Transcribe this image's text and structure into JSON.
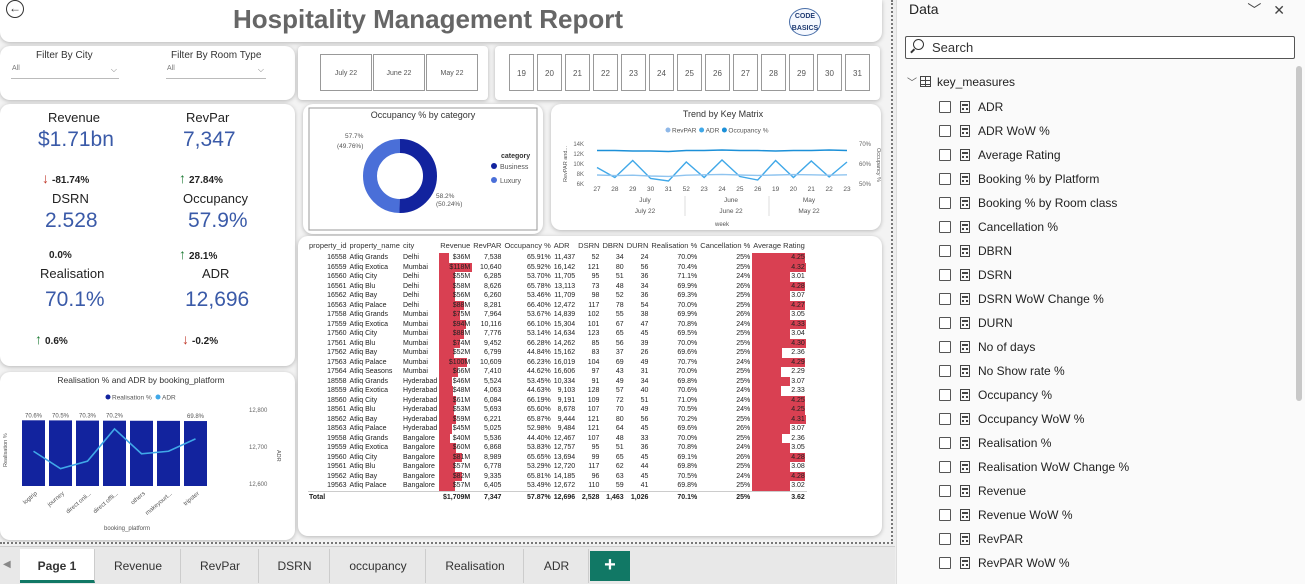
{
  "report": {
    "title": "Hospitality Management Report",
    "logo_text": "CODE BASICS"
  },
  "filters": {
    "city": {
      "label": "Filter By City",
      "value": "All"
    },
    "room_type": {
      "label": "Filter By Room Type",
      "value": "All"
    }
  },
  "months": [
    "July 22",
    "June 22",
    "May 22"
  ],
  "weeks": [
    "19",
    "20",
    "21",
    "22",
    "23",
    "24",
    "25",
    "26",
    "27",
    "28",
    "29",
    "30",
    "31"
  ],
  "kpis": {
    "revenue": {
      "label": "Revenue",
      "value": "$1.71bn",
      "change": "-81.74%"
    },
    "revpar": {
      "label": "RevPar",
      "value": "7,347",
      "change": "27.84%"
    },
    "dsrn": {
      "label": "DSRN",
      "value": "2.528",
      "change": "0.0%"
    },
    "occupancy": {
      "label": "Occupancy",
      "value": "57.9%",
      "change": "28.1%"
    },
    "realisation": {
      "label": "Realisation",
      "value": "70.1%",
      "change": "0.6%"
    },
    "adr": {
      "label": "ADR",
      "value": "12,696",
      "change": "-0.2%"
    }
  },
  "colors": {
    "business": "#12239e",
    "luxury": "#4a6fd8",
    "bar_red": "#d94052",
    "kpi_blue": "#3a5aa8",
    "accent": "#117865",
    "adr_line": "#40a8e8"
  },
  "chart_data": [
    {
      "type": "pie",
      "title": "Occupancy % by category",
      "legend_title": "category",
      "categories": [
        "Business",
        "Luxury"
      ],
      "values": [
        50.24,
        49.76
      ],
      "labels": [
        [
          "58.2%",
          "(50.24%)"
        ],
        [
          "57.7%",
          "(49.76%)"
        ]
      ]
    },
    {
      "type": "line",
      "title": "Trend by Key Matrix",
      "series_names": [
        "RevPAR",
        "ADR",
        "Occupancy %"
      ],
      "x": [
        "27",
        "28",
        "29",
        "30",
        "31",
        "52",
        "23",
        "24",
        "25",
        "26",
        "19",
        "20",
        "21",
        "22",
        "23"
      ],
      "x_groups": [
        {
          "month": "July",
          "label": "July 22"
        },
        {
          "month": "June",
          "label": "June 22"
        },
        {
          "month": "May",
          "label": "May 22"
        }
      ],
      "xlabel": "week",
      "ylabel": "RevPAR and...",
      "ylabel_right": "Occupancy %",
      "yticks_left": [
        "14K",
        "12K",
        "10K",
        "8K",
        "6K"
      ],
      "yticks_right": [
        "70%",
        "60%",
        "50%"
      ],
      "series": [
        {
          "name": "ADR",
          "values": [
            12.7,
            12.7,
            12.6,
            12.6,
            12.5,
            12.7,
            12.7,
            12.8,
            12.7,
            12.7,
            12.6,
            12.7,
            12.7,
            12.8,
            12.7
          ]
        },
        {
          "name": "RevPAR",
          "values": [
            9.3,
            7.3,
            10.7,
            7.1,
            6.6,
            10.4,
            7.3,
            10.8,
            7.5,
            6.8,
            10.7,
            7.3,
            10.6,
            7.4,
            10.4
          ]
        },
        {
          "name": "Occupancy %",
          "values": [
            56.5,
            56.2,
            56.4,
            56.0,
            55.8,
            56.4,
            56.6,
            56.8,
            56.5,
            56.3,
            56.5,
            56.7,
            56.6,
            56.4,
            56.6
          ]
        }
      ],
      "ylim": [
        6,
        14
      ]
    },
    {
      "type": "bar",
      "title": "Realisation % and ADR by booking_platform",
      "series_names": [
        "Realisation %",
        "ADR"
      ],
      "categories": [
        "logtrip",
        "journey",
        "direct onli...",
        "direct offli...",
        "others",
        "makeyourt...",
        "tripster"
      ],
      "values": [
        70.6,
        70.5,
        70.3,
        70.2,
        70.1,
        70.0,
        69.8
      ],
      "value_labels": [
        "70.6%",
        "70.5%",
        "70.3%",
        "70.2%",
        "",
        "",
        "69.8%"
      ],
      "adr": [
        12690,
        12620,
        12650,
        12780,
        12680,
        12690,
        12740
      ],
      "ylabel": "Realisation %",
      "ylabel_right": "ADR",
      "xlabel": "booking_platform",
      "yticks_right": [
        "12,800",
        "12,700",
        "12,600"
      ]
    },
    {
      "type": "table",
      "columns": [
        "property_id",
        "property_name",
        "city",
        "Revenue",
        "RevPAR",
        "Occupancy %",
        "ADR",
        "DSRN",
        "DBRN",
        "DURN",
        "Realisation %",
        "Cancellation %",
        "Average Rating"
      ],
      "rows": [
        [
          "16558",
          "Atliq Grands",
          "Delhi",
          "$36M",
          "7,538",
          "65.91%",
          "11,437",
          "52",
          "34",
          "24",
          "70.0%",
          "25%",
          "4.25"
        ],
        [
          "16559",
          "Atliq Exotica",
          "Mumbai",
          "$118M",
          "10,640",
          "65.92%",
          "16,142",
          "121",
          "80",
          "56",
          "70.4%",
          "25%",
          "4.32"
        ],
        [
          "16560",
          "Atliq City",
          "Delhi",
          "$55M",
          "6,285",
          "53.70%",
          "11,705",
          "95",
          "51",
          "36",
          "71.1%",
          "24%",
          "3.01"
        ],
        [
          "16561",
          "Atliq Blu",
          "Delhi",
          "$58M",
          "8,626",
          "65.78%",
          "13,113",
          "73",
          "48",
          "34",
          "69.9%",
          "26%",
          "4.28"
        ],
        [
          "16562",
          "Atliq Bay",
          "Delhi",
          "$56M",
          "6,260",
          "53.46%",
          "11,709",
          "98",
          "52",
          "36",
          "69.3%",
          "25%",
          "3.07"
        ],
        [
          "16563",
          "Atliq Palace",
          "Delhi",
          "$88M",
          "8,281",
          "66.40%",
          "12,472",
          "117",
          "78",
          "54",
          "70.0%",
          "25%",
          "4.27"
        ],
        [
          "17558",
          "Atliq Grands",
          "Mumbai",
          "$75M",
          "7,964",
          "53.67%",
          "14,839",
          "102",
          "55",
          "38",
          "69.9%",
          "26%",
          "3.05"
        ],
        [
          "17559",
          "Atliq Exotica",
          "Mumbai",
          "$94M",
          "10,116",
          "66.10%",
          "15,304",
          "101",
          "67",
          "47",
          "70.8%",
          "24%",
          "4.33"
        ],
        [
          "17560",
          "Atliq City",
          "Mumbai",
          "$88M",
          "7,776",
          "53.14%",
          "14,634",
          "123",
          "65",
          "45",
          "69.5%",
          "25%",
          "3.04"
        ],
        [
          "17561",
          "Atliq Blu",
          "Mumbai",
          "$74M",
          "9,452",
          "66.28%",
          "14,262",
          "85",
          "56",
          "39",
          "70.0%",
          "25%",
          "4.30"
        ],
        [
          "17562",
          "Atliq Bay",
          "Mumbai",
          "$52M",
          "6,799",
          "44.84%",
          "15,162",
          "83",
          "37",
          "26",
          "69.6%",
          "25%",
          "2.36"
        ],
        [
          "17563",
          "Atliq Palace",
          "Mumbai",
          "$100M",
          "10,609",
          "66.23%",
          "16,019",
          "104",
          "69",
          "49",
          "70.7%",
          "24%",
          "4.29"
        ],
        [
          "17564",
          "Atliq Seasons",
          "Mumbai",
          "$66M",
          "7,410",
          "44.62%",
          "16,606",
          "97",
          "43",
          "31",
          "70.0%",
          "25%",
          "2.29"
        ],
        [
          "18558",
          "Atliq Grands",
          "Hyderabad",
          "$46M",
          "5,524",
          "53.45%",
          "10,334",
          "91",
          "49",
          "34",
          "69.8%",
          "25%",
          "3.07"
        ],
        [
          "18559",
          "Atliq Exotica",
          "Hyderabad",
          "$48M",
          "4,063",
          "44.63%",
          "9,103",
          "128",
          "57",
          "40",
          "70.6%",
          "24%",
          "2.33"
        ],
        [
          "18560",
          "Atliq City",
          "Hyderabad",
          "$61M",
          "6,084",
          "66.19%",
          "9,191",
          "109",
          "72",
          "51",
          "71.0%",
          "24%",
          "4.25"
        ],
        [
          "18561",
          "Atliq Blu",
          "Hyderabad",
          "$53M",
          "5,693",
          "65.60%",
          "8,678",
          "107",
          "70",
          "49",
          "70.5%",
          "24%",
          "4.25"
        ],
        [
          "18562",
          "Atliq Bay",
          "Hyderabad",
          "$59M",
          "6,221",
          "65.87%",
          "9,444",
          "121",
          "80",
          "56",
          "70.2%",
          "25%",
          "4.31"
        ],
        [
          "18563",
          "Atliq Palace",
          "Hyderabad",
          "$45M",
          "5,025",
          "52.98%",
          "9,484",
          "121",
          "64",
          "45",
          "69.6%",
          "26%",
          "3.07"
        ],
        [
          "19558",
          "Atliq Grands",
          "Bangalore",
          "$40M",
          "5,536",
          "44.40%",
          "12,467",
          "107",
          "48",
          "33",
          "70.0%",
          "25%",
          "2.36"
        ],
        [
          "19559",
          "Atliq Exotica",
          "Bangalore",
          "$60M",
          "6,868",
          "53.83%",
          "12,757",
          "95",
          "51",
          "36",
          "70.8%",
          "24%",
          "3.05"
        ],
        [
          "19560",
          "Atliq City",
          "Bangalore",
          "$81M",
          "8,989",
          "65.65%",
          "13,694",
          "99",
          "65",
          "45",
          "69.1%",
          "26%",
          "4.28"
        ],
        [
          "19561",
          "Atliq Blu",
          "Bangalore",
          "$57M",
          "6,778",
          "53.29%",
          "12,720",
          "117",
          "62",
          "44",
          "69.8%",
          "25%",
          "3.08"
        ],
        [
          "19562",
          "Atliq Bay",
          "Bangalore",
          "$82M",
          "9,335",
          "65.81%",
          "14,185",
          "96",
          "63",
          "45",
          "70.5%",
          "24%",
          "4.28"
        ],
        [
          "19563",
          "Atliq Palace",
          "Bangalore",
          "$57M",
          "6,405",
          "53.49%",
          "12,672",
          "110",
          "59",
          "41",
          "69.8%",
          "25%",
          "3.02"
        ]
      ],
      "total": [
        "Total",
        "",
        "",
        "$1,709M",
        "7,347",
        "57.87%",
        "12,696",
        "2,528",
        "1,463",
        "1,026",
        "70.1%",
        "25%",
        "3.62"
      ]
    }
  ],
  "data_pane": {
    "title": "Data",
    "search_placeholder": "Search",
    "table_name": "key_measures",
    "fields": [
      "ADR",
      "ADR WoW %",
      "Average Rating",
      "Booking % by Platform",
      "Booking % by Room class",
      "Cancellation %",
      "DBRN",
      "DSRN",
      "DSRN WoW Change %",
      "DURN",
      "No of days",
      "No Show rate %",
      "Occupancy %",
      "Occupancy WoW %",
      "Realisation %",
      "Realisation WoW Change %",
      "Revenue",
      "Revenue WoW %",
      "RevPAR",
      "RevPAR WoW %"
    ]
  },
  "tabs": [
    "Page 1",
    "Revenue",
    "RevPar",
    "DSRN",
    "occupancy",
    "Realisation",
    "ADR"
  ],
  "add_tab_label": "+"
}
